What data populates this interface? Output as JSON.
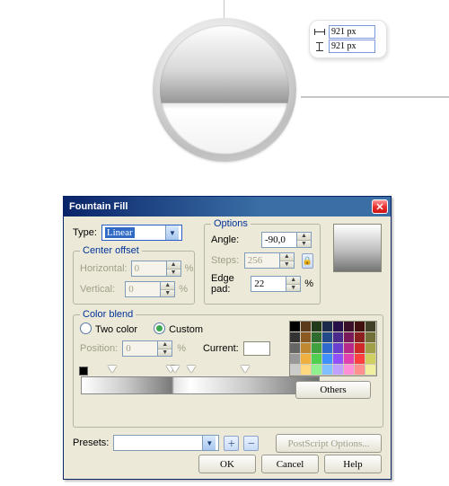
{
  "canvas": {
    "measure_w": "921 px",
    "measure_h": "921 px"
  },
  "dialog": {
    "title": "Fountain Fill",
    "type_label": "Type:",
    "type_value": "Linear",
    "center_offset": {
      "legend": "Center offset",
      "horizontal_label": "Horizontal:",
      "horizontal_value": "0",
      "vertical_label": "Vertical:",
      "vertical_value": "0",
      "pct": "%"
    },
    "options": {
      "legend": "Options",
      "angle_label": "Angle:",
      "angle_value": "-90,0",
      "steps_label": "Steps:",
      "steps_value": "256",
      "edgepad_label": "Edge pad:",
      "edgepad_value": "22",
      "pct": "%"
    },
    "color_blend": {
      "legend": "Color blend",
      "two_color_label": "Two color",
      "custom_label": "Custom",
      "position_label": "Position:",
      "position_value": "0",
      "pct": "%",
      "current_label": "Current:",
      "others_label": "Others"
    },
    "presets_label": "Presets:",
    "postscript_label": "PostScript Options...",
    "ok_label": "OK",
    "cancel_label": "Cancel",
    "help_label": "Help"
  },
  "swatches": [
    "#000000",
    "#5a3a1a",
    "#203a1a",
    "#1a2a4a",
    "#27104a",
    "#3a0f2a",
    "#401010",
    "#404028",
    "#333333",
    "#8a5a22",
    "#2f6a2f",
    "#224a8a",
    "#4a2a8a",
    "#7a1a5a",
    "#8a2020",
    "#707038",
    "#666666",
    "#c08830",
    "#3fa03f",
    "#2f6acf",
    "#6a3fcf",
    "#b72a8a",
    "#cf2a2a",
    "#a0a048",
    "#999999",
    "#f0b040",
    "#50d050",
    "#3f90ff",
    "#9050ff",
    "#e040b0",
    "#ff4040",
    "#d0d060",
    "#cccccc",
    "#ffd880",
    "#90f090",
    "#80c0ff",
    "#c0a0ff",
    "#ff90d8",
    "#ff9090",
    "#f0f0a0"
  ]
}
